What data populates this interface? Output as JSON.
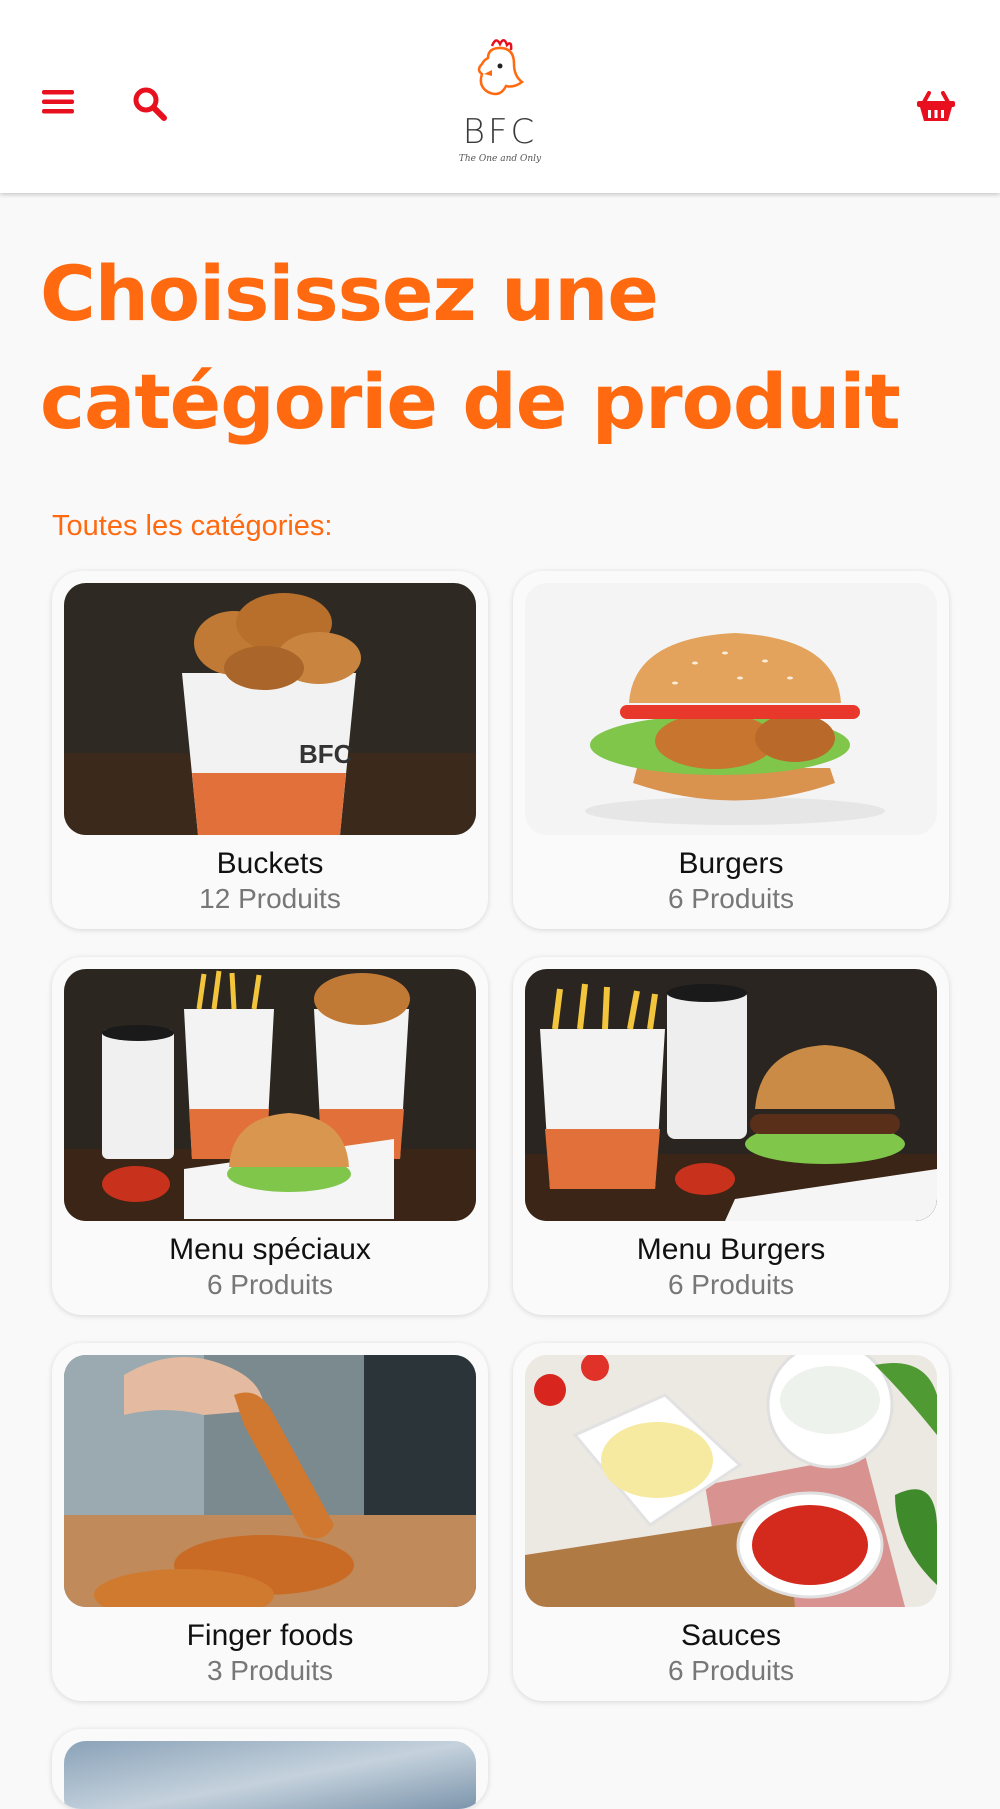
{
  "header": {
    "menu_icon": "hamburger-menu-icon",
    "search_icon": "search-icon",
    "basket_icon": "shopping-basket-icon",
    "logo_text": "BFC",
    "logo_tagline": "The One and Only",
    "icon_color": "#e8101e"
  },
  "page": {
    "title_line1": "Choisissez une",
    "title_line2": "catégorie de produit",
    "section_label": "Toutes les catégories:",
    "accent_color": "#ff6a10"
  },
  "categories": [
    {
      "name": "Buckets",
      "count": "12 Produits"
    },
    {
      "name": "Burgers",
      "count": "6 Produits"
    },
    {
      "name": "Menu spéciaux",
      "count": "6 Produits"
    },
    {
      "name": "Menu Burgers",
      "count": "6 Produits"
    },
    {
      "name": "Finger foods",
      "count": "3 Produits"
    },
    {
      "name": "Sauces",
      "count": "6 Produits"
    }
  ]
}
